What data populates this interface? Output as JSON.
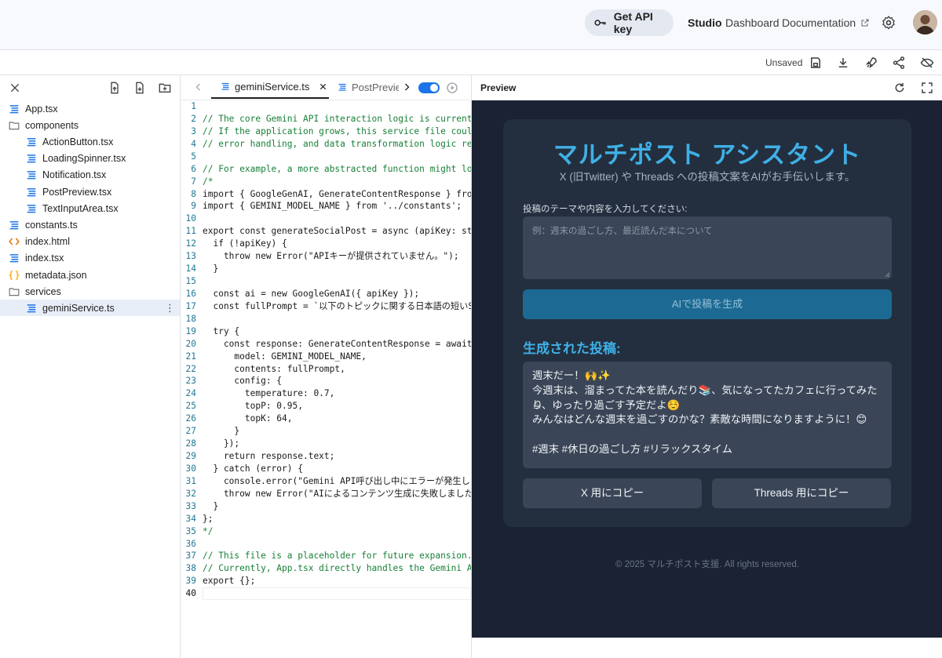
{
  "topbar": {
    "api_key_label": "Get API key",
    "nav": {
      "studio": "Studio",
      "dashboard": "Dashboard",
      "documentation": "Documentation"
    }
  },
  "toolbar": {
    "status": "Unsaved"
  },
  "file_tree": {
    "items": [
      {
        "name": "App.tsx",
        "type": "file"
      },
      {
        "name": "components",
        "type": "folder"
      },
      {
        "name": "ActionButton.tsx",
        "type": "file"
      },
      {
        "name": "LoadingSpinner.tsx",
        "type": "file"
      },
      {
        "name": "Notification.tsx",
        "type": "file"
      },
      {
        "name": "PostPreview.tsx",
        "type": "file"
      },
      {
        "name": "TextInputArea.tsx",
        "type": "file"
      },
      {
        "name": "constants.ts",
        "type": "file"
      },
      {
        "name": "index.html",
        "type": "html"
      },
      {
        "name": "index.tsx",
        "type": "file"
      },
      {
        "name": "metadata.json",
        "type": "json"
      },
      {
        "name": "services",
        "type": "folder"
      },
      {
        "name": "geminiService.ts",
        "type": "file",
        "selected": true
      }
    ]
  },
  "editor": {
    "tabs": [
      {
        "label": "geminiService.ts",
        "active": true
      },
      {
        "label": "PostPreview.tsx",
        "active": false
      }
    ],
    "current_line": 40,
    "lines": [
      "",
      "// The core Gemini API interaction logic is currently",
      "// If the application grows, this service file could b",
      "// error handling, and data transformation logic relat",
      "",
      "// For example, a more abstracted function might look",
      "/*",
      "import { GoogleGenAI, GenerateContentResponse } from '",
      "import { GEMINI_MODEL_NAME } from '../constants';",
      "",
      "export const generateSocialPost = async (apiKey: strin",
      "  if (!apiKey) {",
      "    throw new Error(\"APIキーが提供されていません。\");",
      "  }",
      "",
      "  const ai = new GoogleGenAI({ apiKey });",
      "  const fullPrompt = `以下のトピックに関する日本語の短いSNS",
      "",
      "  try {",
      "    const response: GenerateContentResponse = await a",
      "      model: GEMINI_MODEL_NAME,",
      "      contents: fullPrompt,",
      "      config: {",
      "        temperature: 0.7,",
      "        topP: 0.95,",
      "        topK: 64,",
      "      }",
      "    });",
      "    return response.text;",
      "  } catch (error) {",
      "    console.error(\"Gemini API呼び出し中にエラーが発生しまし",
      "    throw new Error(\"AIによるコンテンツ生成に失敗しました。\"",
      "  }",
      "};",
      "*/",
      "",
      "// This file is a placeholder for future expansion.",
      "// Currently, App.tsx directly handles the Gemini API",
      "export {};",
      ""
    ]
  },
  "preview": {
    "header_title": "Preview",
    "app": {
      "title": "マルチポスト アシスタント",
      "subtitle": "X (旧Twitter) や Threads への投稿文案をAIがお手伝いします。",
      "input_label": "投稿のテーマや内容を入力してください:",
      "input_placeholder": "例：週末の過ごし方、最近読んだ本について",
      "generate_button": "AIで投稿を生成",
      "result_heading": "生成された投稿:",
      "result_lines": [
        "週末だー！🙌✨",
        "今週末は、溜まってた本を読んだり📚、気になってたカフェに行ってみたり",
        "☕、ゆったり過ごす予定だよ☺️",
        "みんなはどんな週末を過ごすのかな？素敵な時間になりますように！😊",
        "",
        "#週末 #休日の過ごし方 #リラックスタイム"
      ],
      "copy_x_button": "X 用にコピー",
      "copy_threads_button": "Threads 用にコピー",
      "footer": "© 2025 マルチポスト支援. All rights reserved."
    }
  },
  "colors": {
    "accent": "#3fb0e6",
    "app_background": "#1a2233",
    "card_background": "#232f3f",
    "generate_button": "#1c6a93"
  }
}
